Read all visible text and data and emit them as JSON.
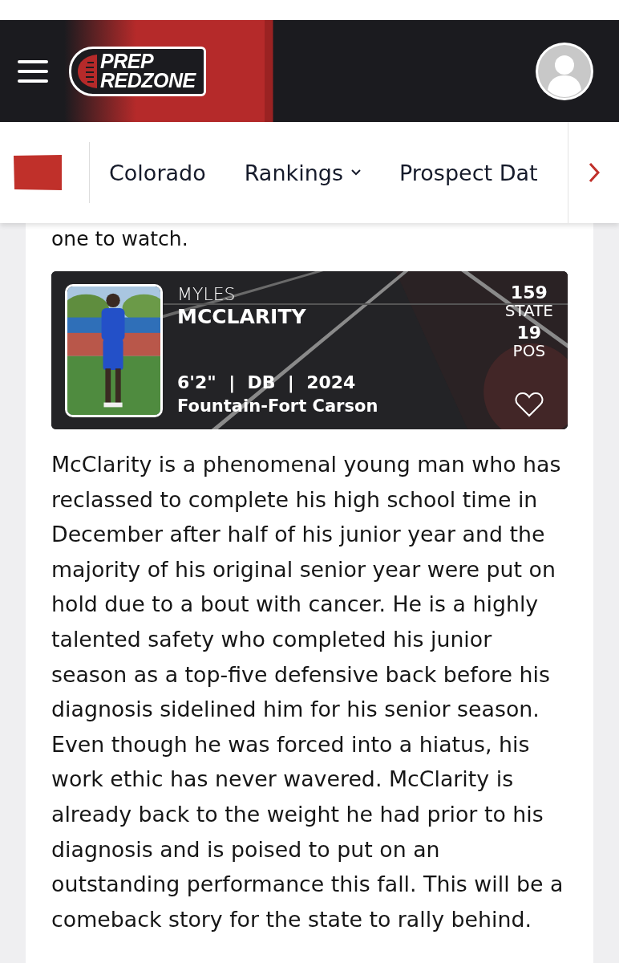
{
  "header": {
    "logo_lines": [
      "PREP",
      "REDZONE"
    ]
  },
  "nav": {
    "items": [
      {
        "label": "Colorado",
        "has_dropdown": false
      },
      {
        "label": "Rankings",
        "has_dropdown": true
      },
      {
        "label": "Prospect Dat",
        "has_dropdown": false
      }
    ]
  },
  "article": {
    "lead_fragment": "one to watch.",
    "player": {
      "first_name": "MYLES",
      "last_name": "MCCLARITY",
      "details": "6'2\"  |  DB  |  2024",
      "school": "Fountain-Fort Carson",
      "ranks": [
        {
          "value": "159",
          "label": "STATE"
        },
        {
          "value": "19",
          "label": "POS"
        }
      ],
      "favorited": false
    },
    "body": "McClarity is a phenomenal young man who has reclassed to complete his high school time in December after half of his junior year and the majority of his original senior year were put on hold due to a bout with cancer. He is a highly talented safety who completed his junior season as a top-five defensive back before his diagnosis sidelined him for his senior season. Even though he was forced into a hiatus, his work ethic has never wavered. McClarity is already back to the weight he had prior to his diagnosis and is poised to put on an outstanding performance this fall. This will be a comeback story for the state to rally behind."
  }
}
